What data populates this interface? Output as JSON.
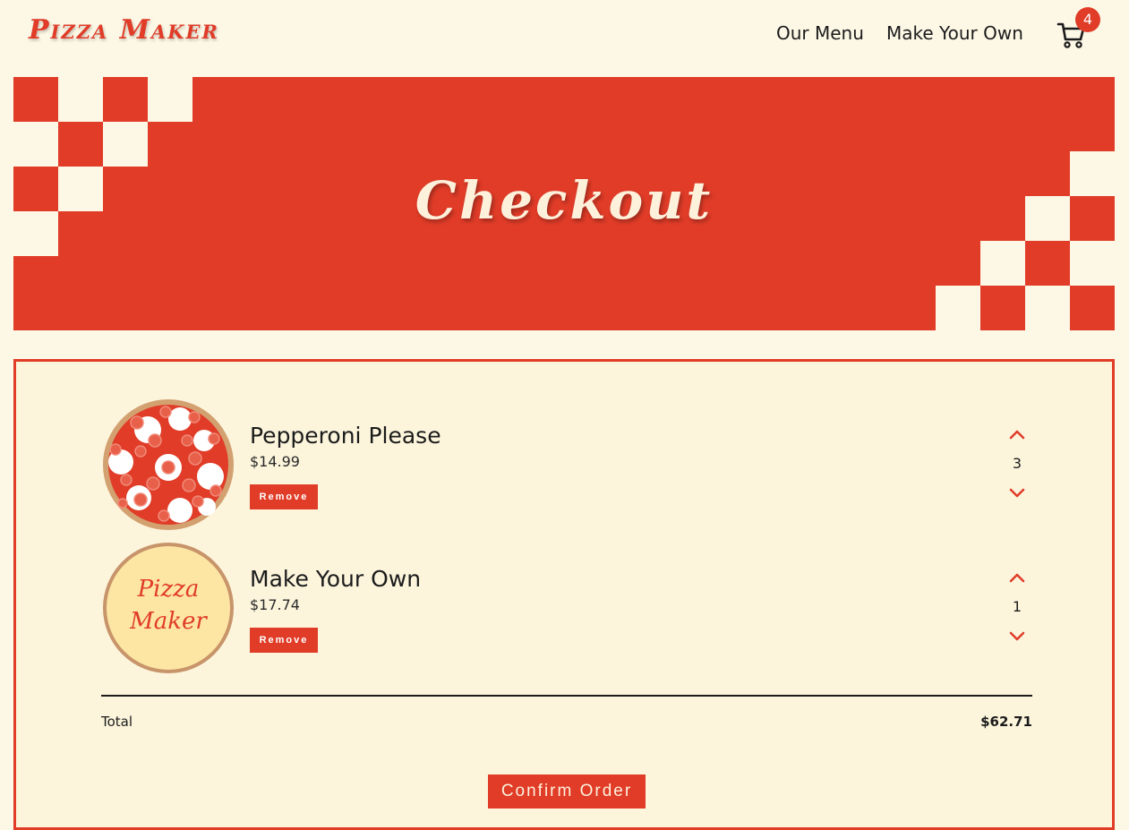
{
  "header": {
    "logo": "Pizza Maker",
    "nav": [
      "Our Menu",
      "Make Your Own"
    ],
    "cart_count": "4"
  },
  "hero": {
    "title": "Checkout"
  },
  "cart": {
    "items": [
      {
        "name": "Pepperoni Please",
        "price": "$14.99",
        "remove_label": "Remove",
        "quantity": "3",
        "thumb": "pepperoni-pizza-image"
      },
      {
        "name": "Make Your Own",
        "price": "$17.74",
        "remove_label": "Remove",
        "quantity": "1",
        "thumb": "pizza-maker-logo-image",
        "thumb_text": [
          "Pizza",
          "Maker"
        ]
      }
    ],
    "total_label": "Total",
    "total_value": "$62.71",
    "confirm_label": "Confirm Order"
  },
  "colors": {
    "accent": "#e03c28",
    "background": "#fdf8e6",
    "panel": "#fcf5dc",
    "cream": "#fdf1dc"
  }
}
